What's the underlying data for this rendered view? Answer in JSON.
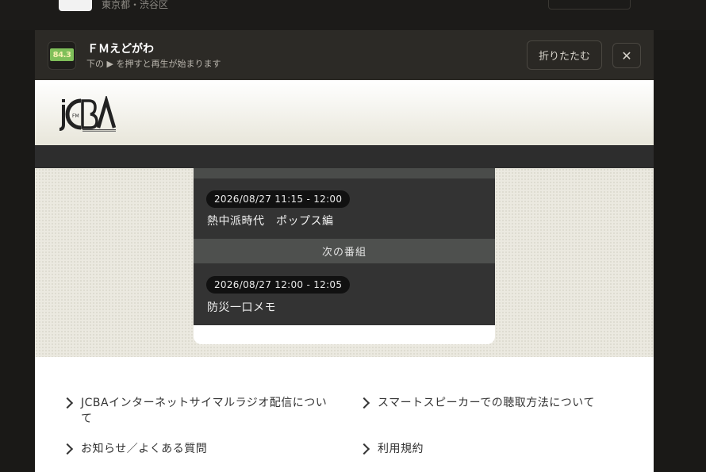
{
  "background": {
    "location": "東京都・渋谷区"
  },
  "player": {
    "station_name": "ＦＭえどがわ",
    "station_logo_text": "84.3",
    "hint": "下の ▶ を押すと再生が始まります",
    "collapse_label": "折りたたむ",
    "close_label": "✕"
  },
  "programs": {
    "current": {
      "time": "2026/08/27 11:15 - 12:00",
      "title": "熱中派時代　ポップス編"
    },
    "next_heading": "次の番組",
    "next": {
      "time": "2026/08/27 12:00 - 12:05",
      "title": "防災一口メモ"
    }
  },
  "links": [
    {
      "label": "JCBAインターネットサイマルラジオ配信について"
    },
    {
      "label": "スマートスピーカーでの聴取方法について"
    },
    {
      "label": "お知らせ／よくある質問"
    },
    {
      "label": "利用規約"
    }
  ],
  "colors": {
    "player_bg": "#2c2a26",
    "card_bg": "#333333",
    "section_head_bg": "#4e504e",
    "logo_green": "#7fbf5a"
  }
}
